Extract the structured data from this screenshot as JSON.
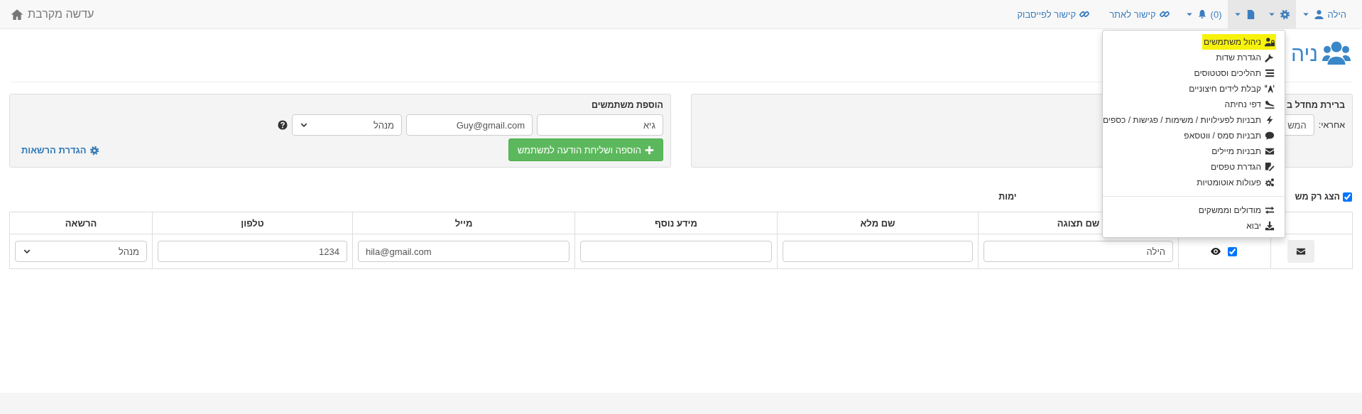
{
  "navbar": {
    "brand": "עדשה מקרבת",
    "items": [
      {
        "kind": "user",
        "label": "הילה",
        "shaded": false
      },
      {
        "kind": "settings",
        "shaded": true
      },
      {
        "kind": "file",
        "shaded": true
      },
      {
        "kind": "notifications",
        "label": "(0)",
        "shaded": false
      },
      {
        "kind": "link",
        "label": "קישור לאתר",
        "shaded": false
      },
      {
        "kind": "link",
        "label": "קישור לפייסבוק",
        "shaded": false
      }
    ]
  },
  "page_title": "ניה",
  "default_panel": {
    "title": "ברירת מחדל ב",
    "field_label": "אחראי:",
    "field_value": "המש"
  },
  "add_users": {
    "title": "הוספת משתמשים",
    "name": "גיא",
    "email": "Guy@gmail.com",
    "role": "מנהל",
    "submit": "הוספה ושליחת הודעה למשתמש",
    "permissions_link": "הגדרת הרשאות"
  },
  "filter": {
    "checked": true,
    "label": "הצג רק מש",
    "label_tail": "ימות"
  },
  "table": {
    "columns": [
      "שם תצוגה",
      "שם מלא",
      "מידע נוסף",
      "מייל",
      "טלפון",
      "הרשאה"
    ],
    "rows": [
      {
        "checked": true,
        "display_name": "הילה",
        "email": "hila@gmail.com",
        "phone": "1234",
        "role": "מנהל"
      }
    ]
  },
  "menu": {
    "items": [
      {
        "kind": "item",
        "label": "ניהול משתמשים",
        "highlighted": true
      },
      {
        "kind": "item",
        "label": "הגדרת שדות",
        "highlighted": false
      },
      {
        "kind": "item",
        "label": "תהליכים וסטטוסים",
        "highlighted": false
      },
      {
        "kind": "item",
        "label": "קבלת לידים חיצוניים",
        "highlighted": false
      },
      {
        "kind": "item",
        "label": "דפי נחיתה",
        "highlighted": false
      },
      {
        "kind": "item",
        "label": "תבניות לפעילויות / משימות / פגישות / כספים",
        "highlighted": false
      },
      {
        "kind": "item",
        "label": "תבניות סמס / ווטסאפ",
        "highlighted": false
      },
      {
        "kind": "item",
        "label": "תבניות מיילים",
        "highlighted": false
      },
      {
        "kind": "item",
        "label": "הגדרת טפסים",
        "highlighted": false
      },
      {
        "kind": "item",
        "label": "פעולות אוטומטיות",
        "highlighted": false
      },
      {
        "kind": "divider"
      },
      {
        "kind": "item",
        "label": "מודולים וממשקים",
        "highlighted": false
      },
      {
        "kind": "item",
        "label": "יבוא",
        "highlighted": false
      }
    ]
  }
}
